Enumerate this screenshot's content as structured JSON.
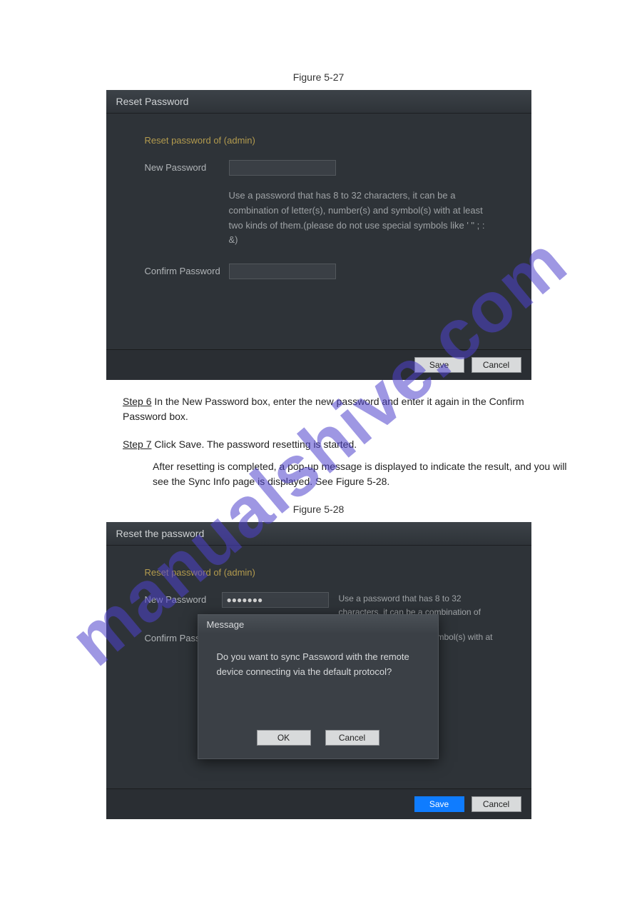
{
  "figure1": {
    "caption": "Figure 5-27",
    "title": "Reset Password",
    "subtitle": "Reset password of (admin)",
    "new_password_label": "New Password",
    "confirm_password_label": "Confirm Password",
    "helper_text": "Use a password that has 8 to 32 characters, it can be a combination of letter(s), number(s) and symbol(s) with at least two kinds of them.(please do not use special symbols like ' \" ; : &)",
    "save_label": "Save",
    "cancel_label": "Cancel"
  },
  "steps": {
    "step6": "In the New Password box, enter the new password and enter it again in the Confirm Password box.",
    "step6_prefix": "Step 6",
    "step7_prefix": "Step 7",
    "step7a": "Click Save. The password resetting is started.",
    "step7b": "After resetting is completed, a pop-up message is displayed to indicate the result, and you will see the Sync Info page is displayed. See Figure 5-28."
  },
  "figure2": {
    "caption": "Figure 5-28",
    "title": "Reset the password",
    "subtitle": "Reset password of (admin)",
    "new_password_label": "New Password",
    "new_password_value": "●●●●●●●",
    "confirm_password_label": "Confirm Passw",
    "helper_text": "Use a password that has 8 to 32 characters, it can be a combination of",
    "helper_tail": "mbol(s) with at",
    "popup_title": "Message",
    "popup_body": "Do you want to sync Password with the remote device connecting via the default protocol?",
    "ok_label": "OK",
    "cancel_label": "Cancel",
    "save_label": "Save",
    "cancel2_label": "Cancel"
  }
}
